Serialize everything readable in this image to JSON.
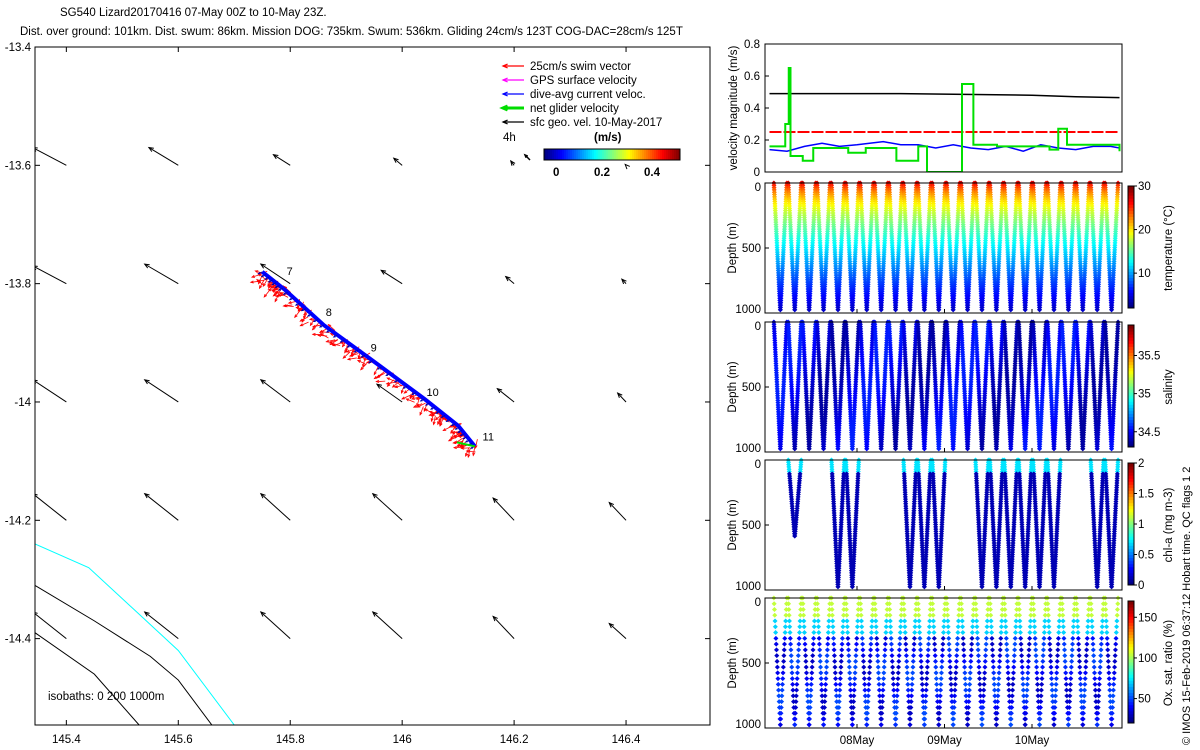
{
  "title": "SG540 Lizard20170416 07-May 00Z to 10-May 23Z.",
  "subtitle": "Dist. over ground: 101km. Dist. swum: 86km. Mission DOG: 735km. Swum: 536km. Gliding 24cm/s 123T COG-DAC=28cm/s 125T",
  "credit": "© IMOS 15-Feb-2019 06:37:12 Hobart time. QC flags 1  2",
  "legend": {
    "items": [
      {
        "label": "25cm/s swim vector",
        "color": "#ff0000"
      },
      {
        "label": "GPS surface velocity",
        "color": "#ff00ff"
      },
      {
        "label": "dive-avg current veloc.",
        "color": "#0000ff"
      },
      {
        "label": "net glider velocity",
        "color": "#00dd00"
      },
      {
        "label": "sfc geo. vel. 10-May-2017",
        "color": "#000000"
      }
    ],
    "age_label": "4h",
    "units_label": "(m/s)",
    "colorbar_ticks": [
      "0",
      "0.2",
      "0.4"
    ]
  },
  "chart_data": {
    "type": "scatter",
    "map": {
      "xlim": [
        145.344,
        146.55
      ],
      "ylim": [
        -14.546,
        -13.4
      ],
      "xticks": [
        "145.4",
        "145.6",
        "145.8",
        "146",
        "146.2",
        "146.4"
      ],
      "yticks": [
        "-13.4",
        "-13.6",
        "-13.8",
        "-14",
        "-14.2",
        "-14.4"
      ],
      "isobath_label": "isobaths: 0   200  1000m",
      "isobaths": [
        {
          "depth": 0,
          "color": "#00ffff",
          "points": [
            [
              145.344,
              -14.24
            ],
            [
              145.44,
              -14.28
            ],
            [
              145.52,
              -14.35
            ],
            [
              145.6,
              -14.42
            ],
            [
              145.7,
              -14.546
            ]
          ]
        },
        {
          "depth": 200,
          "color": "#000000",
          "points": [
            [
              145.344,
              -14.31
            ],
            [
              145.45,
              -14.37
            ],
            [
              145.55,
              -14.43
            ],
            [
              145.6,
              -14.47
            ],
            [
              145.66,
              -14.546
            ]
          ]
        },
        {
          "depth": 1000,
          "color": "#000000",
          "points": [
            [
              145.344,
              -14.39
            ],
            [
              145.45,
              -14.46
            ],
            [
              145.53,
              -14.546
            ]
          ]
        }
      ],
      "track": [
        [
          145.75,
          -13.78
        ],
        [
          145.79,
          -13.81
        ],
        [
          145.86,
          -13.87
        ],
        [
          145.94,
          -13.925
        ],
        [
          146.04,
          -13.995
        ],
        [
          146.1,
          -14.04
        ],
        [
          146.13,
          -14.075
        ]
      ],
      "day_labels": [
        {
          "label": "7",
          "lon": 145.79,
          "lat": -13.785
        },
        {
          "label": "8",
          "lon": 145.86,
          "lat": -13.855
        },
        {
          "label": "9",
          "lon": 145.94,
          "lat": -13.915
        },
        {
          "label": "10",
          "lon": 146.04,
          "lat": -13.99
        },
        {
          "label": "11",
          "lon": 146.14,
          "lat": -14.065
        }
      ],
      "surface_vectors": [
        [
          145.4,
          -13.6,
          -0.4,
          0.2
        ],
        [
          145.6,
          -13.6,
          -0.35,
          0.2
        ],
        [
          145.8,
          -13.6,
          -0.2,
          0.12
        ],
        [
          146.0,
          -13.6,
          -0.1,
          0.08
        ],
        [
          146.2,
          -13.6,
          -0.04,
          0.05
        ],
        [
          146.4,
          -13.6,
          -0.01,
          0.01
        ],
        [
          145.4,
          -13.8,
          -0.4,
          0.2
        ],
        [
          145.6,
          -13.8,
          -0.4,
          0.22
        ],
        [
          145.8,
          -13.8,
          -0.35,
          0.22
        ],
        [
          146.0,
          -13.8,
          -0.25,
          0.15
        ],
        [
          146.2,
          -13.8,
          -0.1,
          0.08
        ],
        [
          146.4,
          -13.8,
          -0.05,
          0.05
        ],
        [
          145.4,
          -14.0,
          -0.4,
          0.25
        ],
        [
          145.6,
          -14.0,
          -0.4,
          0.25
        ],
        [
          145.8,
          -14.0,
          -0.35,
          0.25
        ],
        [
          146.0,
          -14.0,
          -0.3,
          0.2
        ],
        [
          146.2,
          -14.0,
          -0.2,
          0.15
        ],
        [
          146.4,
          -14.0,
          -0.1,
          0.1
        ],
        [
          145.4,
          -14.2,
          -0.4,
          0.3
        ],
        [
          145.6,
          -14.2,
          -0.4,
          0.3
        ],
        [
          145.8,
          -14.2,
          -0.35,
          0.3
        ],
        [
          146.0,
          -14.2,
          -0.35,
          0.3
        ],
        [
          146.2,
          -14.2,
          -0.25,
          0.25
        ],
        [
          146.4,
          -14.2,
          -0.2,
          0.2
        ],
        [
          145.4,
          -14.4,
          -0.4,
          0.3
        ],
        [
          145.6,
          -14.4,
          -0.4,
          0.3
        ],
        [
          145.8,
          -14.4,
          -0.35,
          0.3
        ],
        [
          146.0,
          -14.4,
          -0.35,
          0.3
        ],
        [
          146.2,
          -14.4,
          -0.25,
          0.25
        ],
        [
          146.4,
          -14.4,
          -0.2,
          0.17
        ]
      ]
    },
    "velocity": {
      "ylabel": "velocity magnitude (m/s)",
      "ylim": [
        0,
        0.8
      ],
      "yticks": [
        "0",
        "0.2",
        "0.4",
        "0.6",
        "0.8"
      ],
      "series": [
        {
          "name": "sfc geo. vel.",
          "color": "#000000",
          "points": [
            [
              7,
              0.49
            ],
            [
              8.5,
              0.49
            ],
            [
              10,
              0.48
            ],
            [
              10.5,
              0.47
            ],
            [
              11,
              0.465
            ]
          ]
        },
        {
          "name": "swim vector",
          "color": "#ff0000",
          "points": [
            [
              7,
              0.25
            ],
            [
              11,
              0.25
            ]
          ]
        },
        {
          "name": "dive-avg current",
          "color": "#0000ff",
          "points": [
            [
              7,
              0.14
            ],
            [
              7.2,
              0.13
            ],
            [
              7.4,
              0.16
            ],
            [
              7.6,
              0.18
            ],
            [
              7.8,
              0.16
            ],
            [
              8.0,
              0.17
            ],
            [
              8.3,
              0.19
            ],
            [
              8.5,
              0.17
            ],
            [
              8.7,
              0.17
            ],
            [
              8.9,
              0.15
            ],
            [
              9.1,
              0.17
            ],
            [
              9.3,
              0.15
            ],
            [
              9.5,
              0.14
            ],
            [
              9.7,
              0.16
            ],
            [
              9.9,
              0.13
            ],
            [
              10.1,
              0.17
            ],
            [
              10.3,
              0.15
            ],
            [
              10.5,
              0.14
            ],
            [
              10.7,
              0.16
            ],
            [
              10.9,
              0.16
            ],
            [
              11,
              0.15
            ]
          ]
        },
        {
          "name": "net glider velocity",
          "color": "#00e000",
          "points": [
            [
              7,
              0.16
            ],
            [
              7.18,
              0.3
            ],
            [
              7.22,
              0.65
            ],
            [
              7.24,
              0.1
            ],
            [
              7.38,
              0.07
            ],
            [
              7.5,
              0.15
            ],
            [
              7.9,
              0.12
            ],
            [
              8.1,
              0.15
            ],
            [
              8.45,
              0.07
            ],
            [
              8.7,
              0.16
            ],
            [
              8.8,
              0.0
            ],
            [
              9.2,
              0.55
            ],
            [
              9.33,
              0.17
            ],
            [
              9.6,
              0.16
            ],
            [
              10.2,
              0.14
            ],
            [
              10.3,
              0.27
            ],
            [
              10.4,
              0.17
            ],
            [
              10.9,
              0.17
            ],
            [
              11,
              0.13
            ]
          ]
        }
      ]
    },
    "time_axis": {
      "xlim_days": [
        6.9,
        11.0
      ],
      "ticks": [
        {
          "day": 8,
          "label": "08May"
        },
        {
          "day": 9,
          "label": "09May"
        },
        {
          "day": 10,
          "label": "10May"
        }
      ]
    },
    "sections": [
      {
        "variable": "temperature",
        "clabel": "temperature (°C)",
        "clim": [
          2,
          30
        ],
        "cticks": [
          {
            "v": 10,
            "t": "10"
          },
          {
            "v": 20,
            "t": "20"
          },
          {
            "v": 30,
            "t": "30"
          }
        ],
        "ylabel": "Depth (m)",
        "yticks": [
          "0",
          "500",
          "1000"
        ],
        "n_dives": 24,
        "max_depth": 1000,
        "profile": "temperature",
        "sparsity": 1
      },
      {
        "variable": "salinity",
        "clabel": "salinity",
        "clim": [
          34.3,
          35.9
        ],
        "cticks": [
          {
            "v": 34.5,
            "t": "34.5"
          },
          {
            "v": 35,
            "t": "35"
          },
          {
            "v": 35.5,
            "t": "35.5"
          }
        ],
        "ylabel": "Depth (m)",
        "yticks": [
          "0",
          "500",
          "1000"
        ],
        "n_dives": 24,
        "max_depth": 1000,
        "profile": "salinity",
        "sparsity": 1
      },
      {
        "variable": "chl-a",
        "clabel": "chl-a (mg m-3)",
        "clim": [
          0,
          2
        ],
        "cticks": [
          {
            "v": 0,
            "t": "0"
          },
          {
            "v": 0.5,
            "t": "0.5"
          },
          {
            "v": 1,
            "t": "1"
          },
          {
            "v": 1.5,
            "t": "1.5"
          },
          {
            "v": 2,
            "t": "2"
          }
        ],
        "ylabel": "Depth (m)",
        "yticks": [
          "0",
          "500",
          "1000"
        ],
        "n_dives": 24,
        "max_depth": 1000,
        "profile": "chl",
        "sparsity": 1
      },
      {
        "variable": "oxygen",
        "clabel": "Ox. sat. ratio (%)",
        "clim": [
          20,
          170
        ],
        "cticks": [
          {
            "v": 50,
            "t": "50"
          },
          {
            "v": 100,
            "t": "100"
          },
          {
            "v": 150,
            "t": "150"
          }
        ],
        "ylabel": "Depth (m)",
        "yticks": [
          "0",
          "500",
          "1000"
        ],
        "n_dives": 24,
        "max_depth": 1000,
        "profile": "oxygen",
        "sparsity": 5
      }
    ]
  }
}
